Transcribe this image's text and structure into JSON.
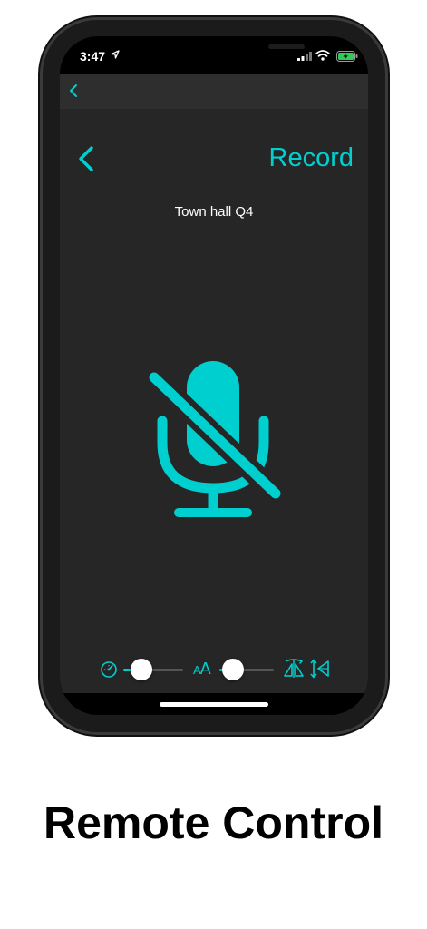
{
  "status_bar": {
    "time": "3:47"
  },
  "nav": {
    "title": "Record"
  },
  "session": {
    "name": "Town hall Q4"
  },
  "microphone": {
    "state": "muted",
    "icon": "mic-slash-icon"
  },
  "controls": {
    "speed_slider": {
      "icon": "speedometer-icon",
      "value": 0.3
    },
    "text_size_slider": {
      "icon": "text-size-icon",
      "label": "AA",
      "value": 0.25
    },
    "mirror_button": {
      "icon": "mirror-horizontal-icon"
    },
    "flip_button": {
      "icon": "flip-vertical-icon"
    }
  },
  "caption": "Remote Control",
  "colors": {
    "accent": "#00d0d0",
    "background": "#262626",
    "nav_bar": "#2e2e2e"
  }
}
